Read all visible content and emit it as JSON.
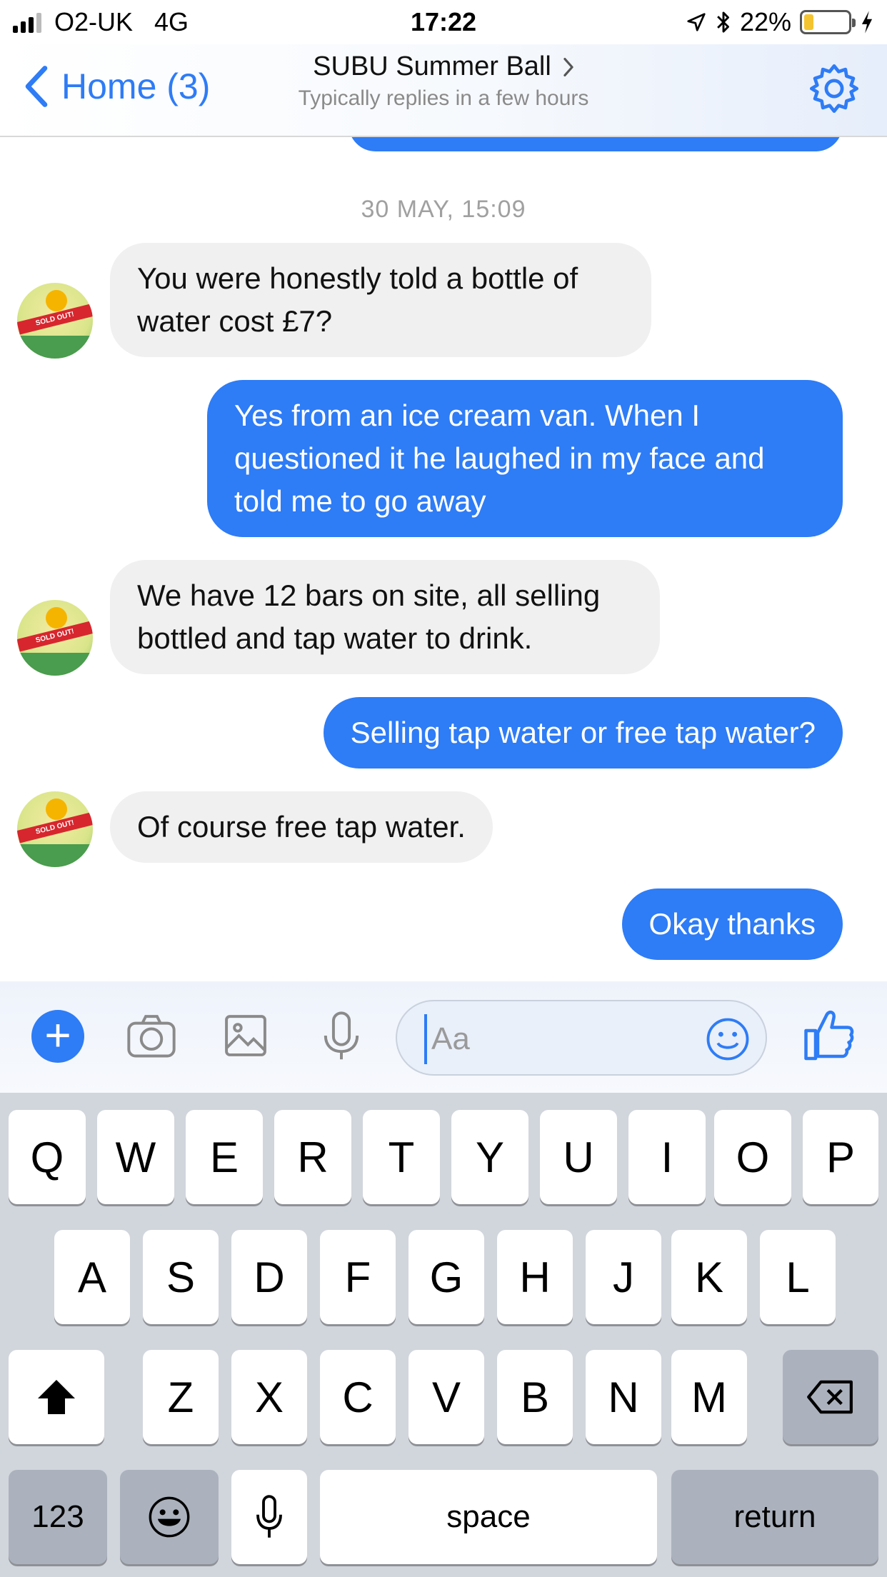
{
  "status_bar": {
    "carrier": "O2-UK",
    "network": "4G",
    "time": "17:22",
    "battery_percent": "22%",
    "battery_level": 0.22,
    "icons": [
      "location-arrow-icon",
      "bluetooth-icon",
      "battery-icon",
      "charging-bolt-icon"
    ]
  },
  "header": {
    "back_label": "Home (3)",
    "title": "SUBU Summer Ball",
    "subtitle": "Typically replies in a few hours",
    "accent_color": "#2e7cf6"
  },
  "conversation": {
    "timestamp": "30 MAY, 15:09",
    "messages": [
      {
        "direction": "incoming",
        "text": "You were honestly told a bottle of water cost £7?"
      },
      {
        "direction": "outgoing",
        "text": "Yes from an ice cream van. When I questioned it he laughed in my face and told me to go away"
      },
      {
        "direction": "incoming",
        "text": "We have 12 bars on site, all selling bottled and tap water to drink."
      },
      {
        "direction": "outgoing",
        "text": "Selling tap water or free tap water?"
      },
      {
        "direction": "incoming",
        "text": "Of course free tap water."
      },
      {
        "direction": "outgoing",
        "text": "Okay thanks"
      }
    ],
    "avatar": {
      "band_text": "SOLD OUT!"
    }
  },
  "composer": {
    "placeholder": "Aa",
    "value": ""
  },
  "keyboard": {
    "row1": [
      "Q",
      "W",
      "E",
      "R",
      "T",
      "Y",
      "U",
      "I",
      "O",
      "P"
    ],
    "row2": [
      "A",
      "S",
      "D",
      "F",
      "G",
      "H",
      "J",
      "K",
      "L"
    ],
    "row3": [
      "Z",
      "X",
      "C",
      "V",
      "B",
      "N",
      "M"
    ],
    "numbers_label": "123",
    "space_label": "space",
    "return_label": "return"
  }
}
